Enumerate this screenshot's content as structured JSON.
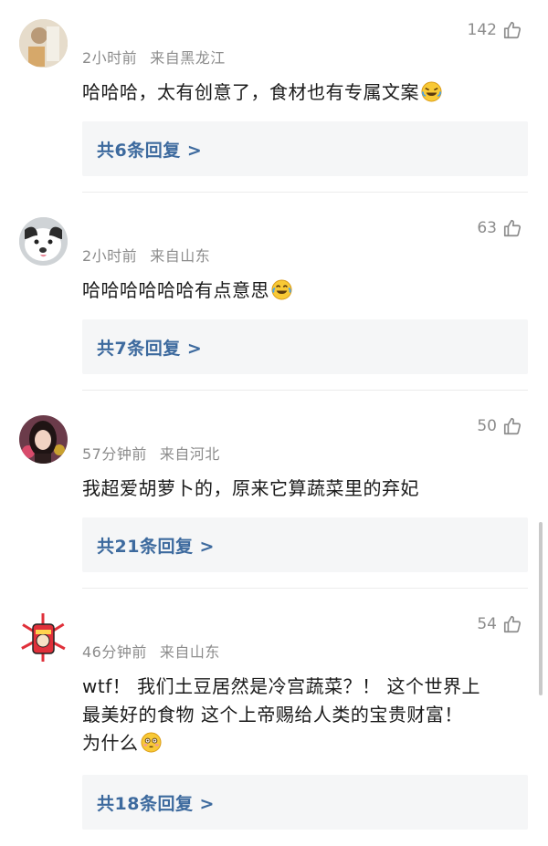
{
  "comments": [
    {
      "time": "2小时前",
      "location": "来自黑龙江",
      "likes": "142",
      "text": "哈哈哈，太有创意了，食材也有专属文案",
      "emoji": "crying-laughing-emoji",
      "replies": "共6条回复 >",
      "avatar": "photo-avatar"
    },
    {
      "time": "2小时前",
      "location": "来自山东",
      "likes": "63",
      "text": "哈哈哈哈哈哈有点意思",
      "emoji": "tears-of-joy-emoji",
      "replies": "共7条回复 >",
      "avatar": "dog-avatar"
    },
    {
      "time": "57分钟前",
      "location": "来自河北",
      "likes": "50",
      "text": "我超爱胡萝卜的，原来它算蔬菜里的弃妃",
      "replies": "共21条回复 >",
      "avatar": "girl-avatar"
    },
    {
      "time": "46分钟前",
      "location": "来自山东",
      "likes": "54",
      "text_lines": [
        "wtf！ 我们土豆居然是冷宫蔬菜？！ 这个世界上",
        "最美好的食物 这个上帝赐给人类的宝贵财富！",
        "为什么"
      ],
      "emoji": "flushed-emoji",
      "replies": "共18条回复 >",
      "avatar": "cartoon-avatar"
    }
  ],
  "icons": {
    "like": "thumbs-up-icon"
  },
  "colors": {
    "reply_link": "#3d6a9e",
    "meta": "#8c8c8c",
    "reply_bg": "#f5f6f7"
  }
}
